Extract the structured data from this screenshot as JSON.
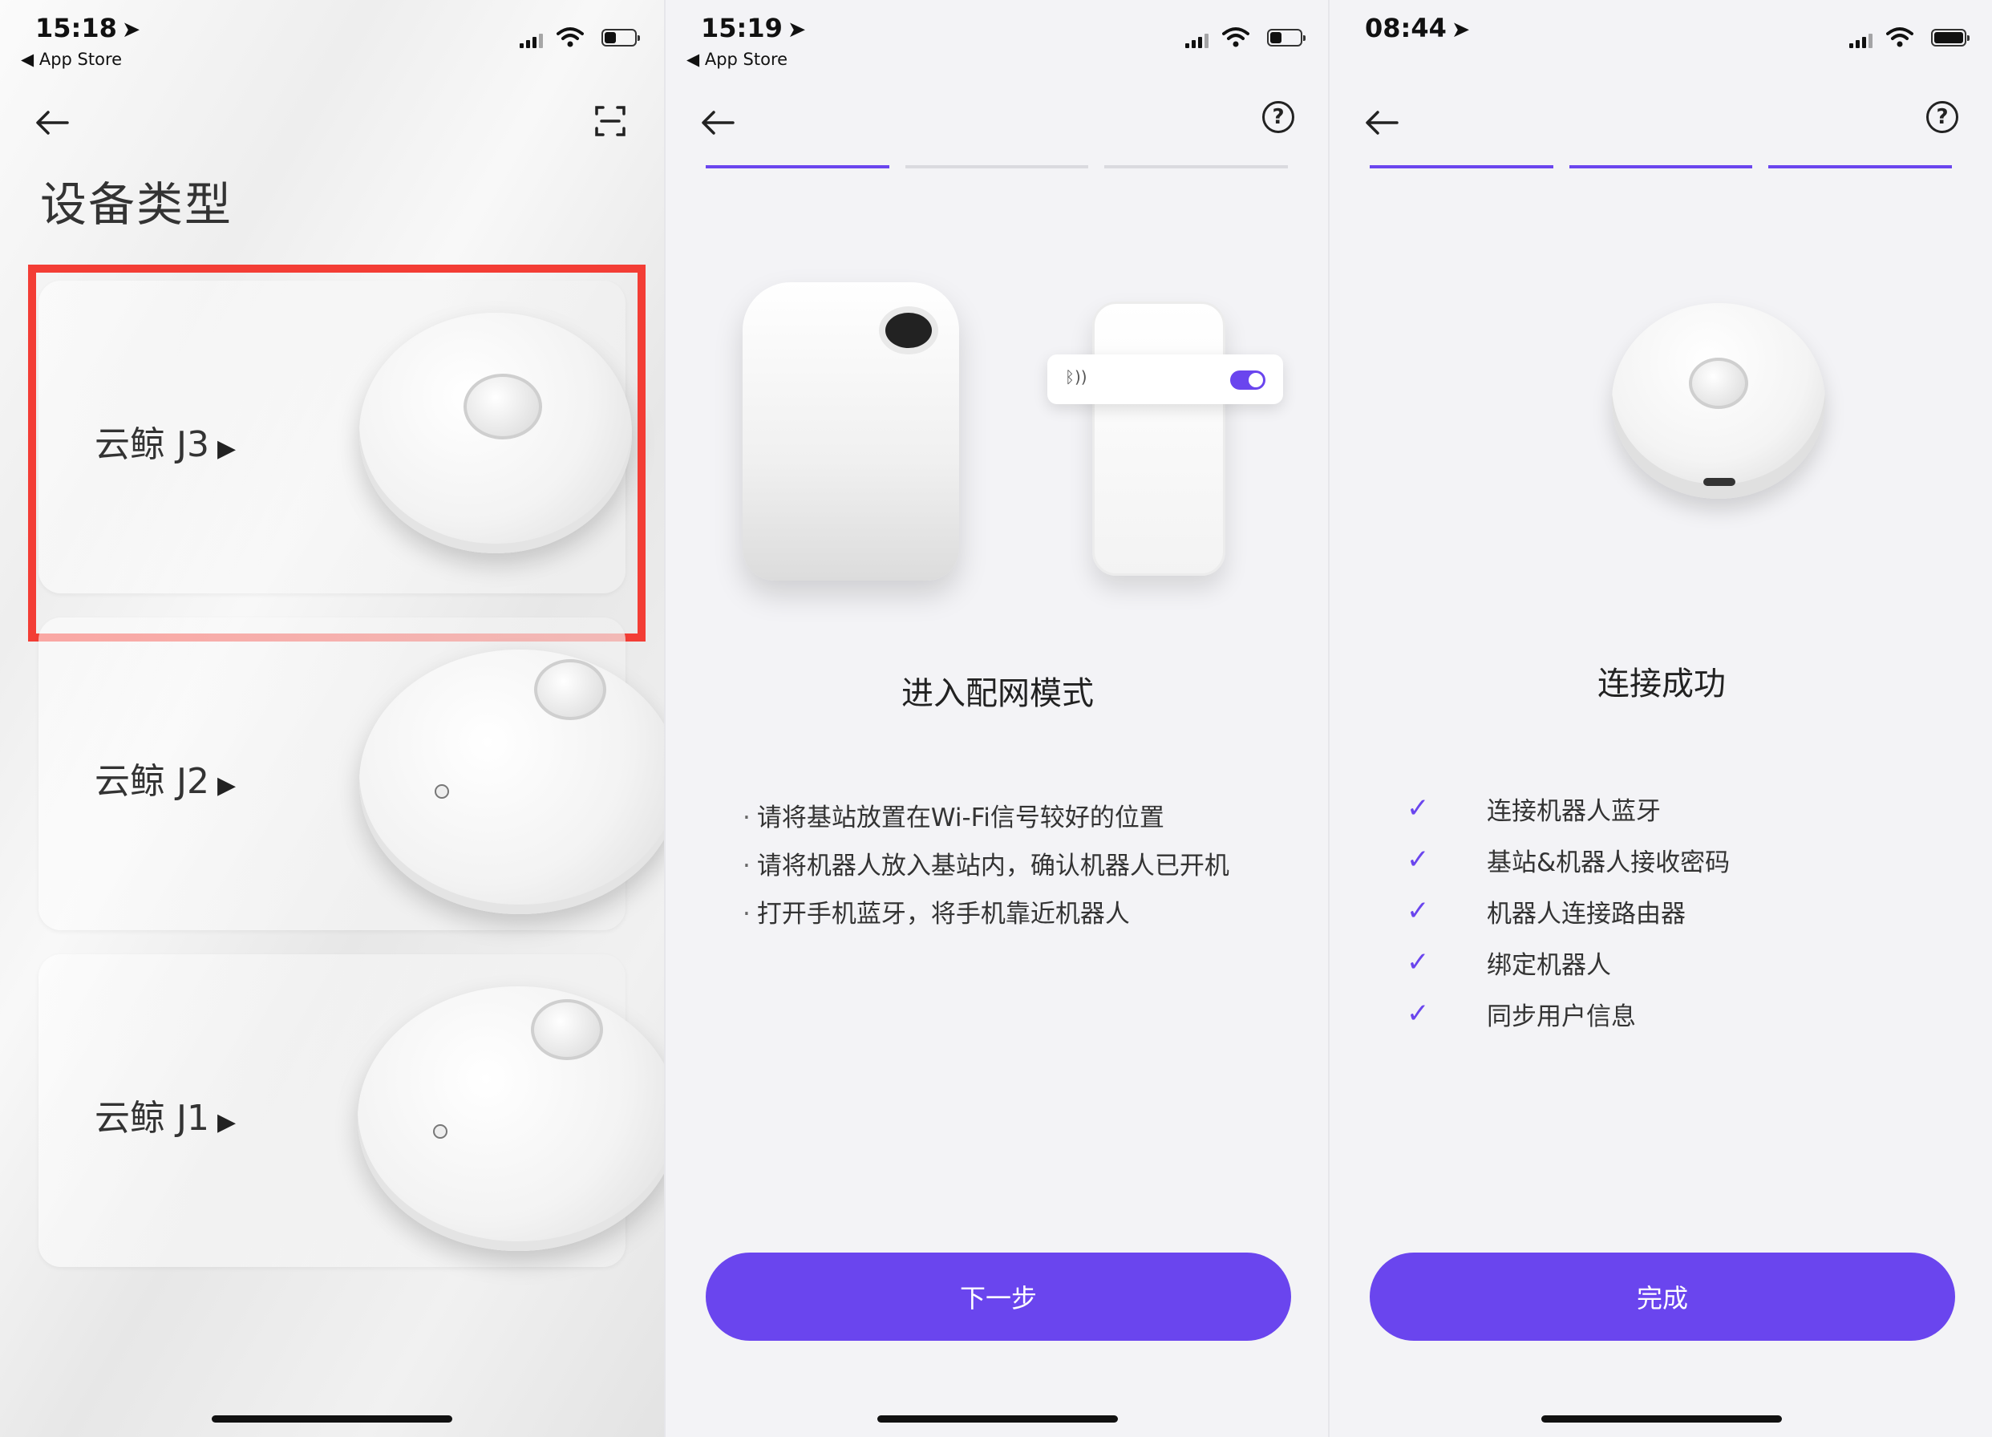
{
  "colors": {
    "accent": "#6a45ee",
    "highlight": "#f33d35"
  },
  "screen1": {
    "status": {
      "time": "15:18",
      "loc_icon": "➤",
      "back_app": "◀ App Store",
      "battery_pct": 0.4
    },
    "title": "设备类型",
    "devices": [
      {
        "name": "云鲸 J3",
        "arrow": "▶"
      },
      {
        "name": "云鲸 J2",
        "arrow": "▶"
      },
      {
        "name": "云鲸 J1",
        "arrow": "▶"
      }
    ]
  },
  "screen2": {
    "status": {
      "time": "15:19",
      "loc_icon": "➤",
      "back_app": "◀ App Store",
      "battery_pct": 0.4
    },
    "help": "?",
    "progress": [
      true,
      false,
      false
    ],
    "bt_label": "ᛒ))",
    "heading": "进入配网模式",
    "steps": [
      "请将基站放置在Wi-Fi信号较好的位置",
      "请将机器人放入基站内，确认机器人已开机",
      "打开手机蓝牙，将手机靠近机器人"
    ],
    "bullet": "·",
    "button": "下一步"
  },
  "screen3": {
    "status": {
      "time": "08:44",
      "loc_icon": "➤",
      "battery_pct": 1.0
    },
    "help": "?",
    "progress": [
      true,
      true,
      true
    ],
    "heading": "连接成功",
    "check_icon": "✓",
    "checks": [
      "连接机器人蓝牙",
      "基站&机器人接收密码",
      "机器人连接路由器",
      "绑定机器人",
      "同步用户信息"
    ],
    "button": "完成"
  }
}
